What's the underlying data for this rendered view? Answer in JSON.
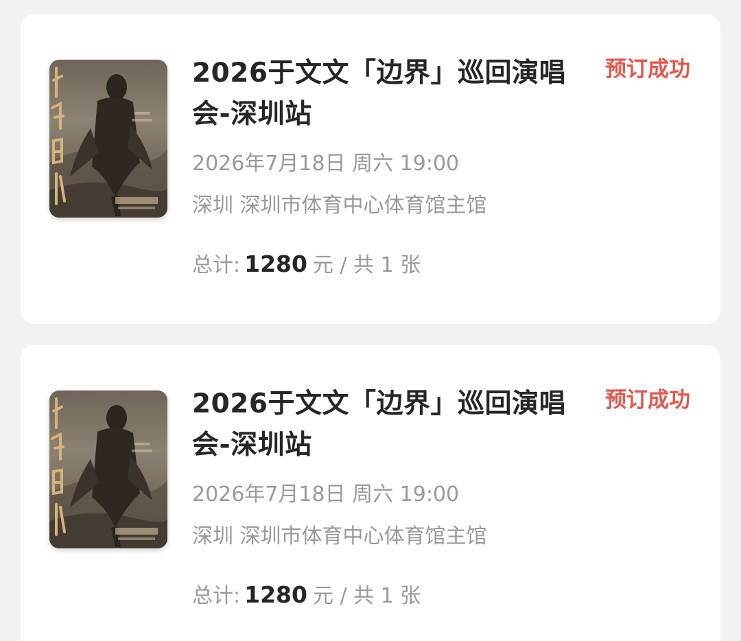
{
  "orders": [
    {
      "title": "2026于文文「边界」巡回演唱会-深圳站",
      "status": "预订成功",
      "datetime": "2026年7月18日 周六 19:00",
      "venue": "深圳 深圳市体育中心体育馆主馆",
      "total_label": "总计:",
      "amount": "1280",
      "unit": "元 / 共 1 张",
      "poster_icon": "concert-poster-image"
    },
    {
      "title": "2026于文文「边界」巡回演唱会-深圳站",
      "status": "预订成功",
      "datetime": "2026年7月18日 周六 19:00",
      "venue": "深圳 深圳市体育中心体育馆主馆",
      "total_label": "总计:",
      "amount": "1280",
      "unit": "元 / 共 1 张",
      "poster_icon": "concert-poster-image"
    }
  ],
  "colors": {
    "background": "#f2f2f2",
    "card": "#ffffff",
    "title": "#262626",
    "secondary": "#999999",
    "status": "#e2574c"
  }
}
